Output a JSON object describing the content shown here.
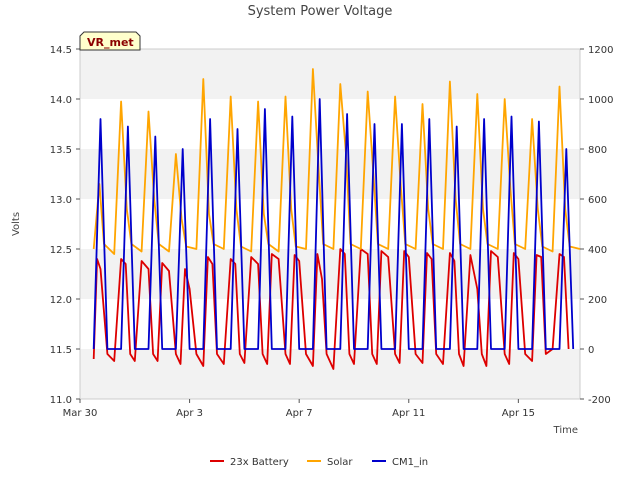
{
  "chart_data": {
    "type": "line",
    "title": "System Power Voltage",
    "xlabel": "Time",
    "ylabel": "Volts",
    "badge": "VR_met",
    "x_range": [
      "2024-03-30",
      "2024-04-17T06:00"
    ],
    "x_ticks": [
      "Mar 30",
      "Apr 3",
      "Apr 7",
      "Apr 11",
      "Apr 15"
    ],
    "x_tick_dates": [
      "2024-03-30",
      "2024-04-03",
      "2024-04-07",
      "2024-04-11",
      "2024-04-15"
    ],
    "ylim_left": [
      11.0,
      14.5
    ],
    "y_ticks_left": [
      "11.0",
      "11.5",
      "12.0",
      "12.5",
      "13.0",
      "13.5",
      "14.0",
      "14.5"
    ],
    "ylim_right": [
      -200,
      1200
    ],
    "y_ticks_right": [
      "-200",
      "0",
      "200",
      "400",
      "600",
      "800",
      "1000",
      "1200"
    ],
    "grid": "horizontal bands",
    "legend_position": "bottom-center",
    "series": [
      {
        "name": "23x Battery",
        "axis": "left",
        "color": "#dd0000",
        "x": [
          "2024-03-30T12:00",
          "2024-03-30T15:00",
          "2024-03-30T18:00",
          "2024-03-31T00:00",
          "2024-03-31T06:00",
          "2024-03-31T12:00",
          "2024-03-31T16:00",
          "2024-03-31T20:00",
          "2024-04-01T00:00",
          "2024-04-01T06:00",
          "2024-04-01T12:00",
          "2024-04-01T16:00",
          "2024-04-01T20:00",
          "2024-04-02T00:00",
          "2024-04-02T06:00",
          "2024-04-02T12:00",
          "2024-04-02T16:00",
          "2024-04-02T20:00",
          "2024-04-03T00:00",
          "2024-04-03T06:00",
          "2024-04-03T12:00",
          "2024-04-03T16:00",
          "2024-04-03T20:00",
          "2024-04-04T00:00",
          "2024-04-04T06:00",
          "2024-04-04T12:00",
          "2024-04-04T16:00",
          "2024-04-04T20:00",
          "2024-04-05T00:00",
          "2024-04-05T06:00",
          "2024-04-05T12:00",
          "2024-04-05T16:00",
          "2024-04-05T20:00",
          "2024-04-06T00:00",
          "2024-04-06T06:00",
          "2024-04-06T12:00",
          "2024-04-06T16:00",
          "2024-04-06T20:00",
          "2024-04-07T00:00",
          "2024-04-07T06:00",
          "2024-04-07T12:00",
          "2024-04-07T16:00",
          "2024-04-07T20:00",
          "2024-04-08T00:00",
          "2024-04-08T06:00",
          "2024-04-08T12:00",
          "2024-04-08T16:00",
          "2024-04-08T20:00",
          "2024-04-09T00:00",
          "2024-04-09T06:00",
          "2024-04-09T12:00",
          "2024-04-09T16:00",
          "2024-04-09T20:00",
          "2024-04-10T00:00",
          "2024-04-10T06:00",
          "2024-04-10T12:00",
          "2024-04-10T16:00",
          "2024-04-10T20:00",
          "2024-04-11T00:00",
          "2024-04-11T06:00",
          "2024-04-11T12:00",
          "2024-04-11T16:00",
          "2024-04-11T20:00",
          "2024-04-12T00:00",
          "2024-04-12T06:00",
          "2024-04-12T12:00",
          "2024-04-12T16:00",
          "2024-04-12T20:00",
          "2024-04-13T00:00",
          "2024-04-13T06:00",
          "2024-04-13T12:00",
          "2024-04-13T16:00",
          "2024-04-13T20:00",
          "2024-04-14T00:00",
          "2024-04-14T06:00",
          "2024-04-14T12:00",
          "2024-04-14T16:00",
          "2024-04-14T20:00",
          "2024-04-15T00:00",
          "2024-04-15T06:00",
          "2024-04-15T12:00",
          "2024-04-15T16:00",
          "2024-04-15T20:00",
          "2024-04-16T00:00",
          "2024-04-16T06:00",
          "2024-04-16T12:00",
          "2024-04-16T16:00",
          "2024-04-16T20:00"
        ],
        "y": [
          11.4,
          12.4,
          12.3,
          11.45,
          11.38,
          12.4,
          12.35,
          11.45,
          11.38,
          12.38,
          12.3,
          11.45,
          11.38,
          12.36,
          12.28,
          11.45,
          11.35,
          12.3,
          12.1,
          11.45,
          11.33,
          12.42,
          12.35,
          11.45,
          11.35,
          12.4,
          12.35,
          11.45,
          11.36,
          12.42,
          12.35,
          11.45,
          11.35,
          12.45,
          12.4,
          11.45,
          11.35,
          12.44,
          12.38,
          11.45,
          11.33,
          12.45,
          12.2,
          11.45,
          11.3,
          12.5,
          12.45,
          11.45,
          11.35,
          12.5,
          12.45,
          11.45,
          11.35,
          12.48,
          12.42,
          11.45,
          11.36,
          12.48,
          12.42,
          11.45,
          11.36,
          12.46,
          12.4,
          11.45,
          11.35,
          12.46,
          12.38,
          11.45,
          11.33,
          12.44,
          12.1,
          11.45,
          11.33,
          12.48,
          12.42,
          11.45,
          11.35,
          12.46,
          12.4,
          11.45,
          11.38,
          12.44,
          12.42,
          11.45,
          11.5,
          12.45,
          12.42,
          11.5
        ]
      },
      {
        "name": "Solar",
        "axis": "right",
        "color": "#ffa500",
        "x": [
          "2024-03-30T12:00",
          "2024-03-30T17:00",
          "2024-03-30T21:00",
          "2024-03-31T06:00",
          "2024-03-31T12:00",
          "2024-03-31T17:00",
          "2024-03-31T21:00",
          "2024-04-01T06:00",
          "2024-04-01T12:00",
          "2024-04-01T17:00",
          "2024-04-01T21:00",
          "2024-04-02T06:00",
          "2024-04-02T12:00",
          "2024-04-02T17:00",
          "2024-04-02T21:00",
          "2024-04-03T06:00",
          "2024-04-03T12:00",
          "2024-04-03T17:00",
          "2024-04-03T21:00",
          "2024-04-04T06:00",
          "2024-04-04T12:00",
          "2024-04-04T17:00",
          "2024-04-04T21:00",
          "2024-04-05T06:00",
          "2024-04-05T12:00",
          "2024-04-05T17:00",
          "2024-04-05T21:00",
          "2024-04-06T06:00",
          "2024-04-06T12:00",
          "2024-04-06T17:00",
          "2024-04-06T21:00",
          "2024-04-07T06:00",
          "2024-04-07T12:00",
          "2024-04-07T17:00",
          "2024-04-07T21:00",
          "2024-04-08T06:00",
          "2024-04-08T12:00",
          "2024-04-08T17:00",
          "2024-04-08T21:00",
          "2024-04-09T06:00",
          "2024-04-09T12:00",
          "2024-04-09T17:00",
          "2024-04-09T21:00",
          "2024-04-10T06:00",
          "2024-04-10T12:00",
          "2024-04-10T17:00",
          "2024-04-10T21:00",
          "2024-04-11T06:00",
          "2024-04-11T12:00",
          "2024-04-11T17:00",
          "2024-04-11T21:00",
          "2024-04-12T06:00",
          "2024-04-12T12:00",
          "2024-04-12T17:00",
          "2024-04-12T21:00",
          "2024-04-13T06:00",
          "2024-04-13T12:00",
          "2024-04-13T17:00",
          "2024-04-13T21:00",
          "2024-04-14T06:00",
          "2024-04-14T12:00",
          "2024-04-14T17:00",
          "2024-04-14T21:00",
          "2024-04-15T06:00",
          "2024-04-15T12:00",
          "2024-04-15T17:00",
          "2024-04-15T21:00",
          "2024-04-16T06:00",
          "2024-04-16T12:00",
          "2024-04-16T17:00",
          "2024-04-16T21:00",
          "2024-04-17T06:00"
        ],
        "y": [
          400,
          660,
          420,
          380,
          990,
          560,
          420,
          390,
          950,
          600,
          420,
          390,
          780,
          520,
          410,
          400,
          1080,
          540,
          420,
          400,
          1010,
          560,
          410,
          390,
          990,
          540,
          420,
          390,
          1010,
          560,
          410,
          400,
          1120,
          720,
          420,
          400,
          1060,
          780,
          420,
          400,
          1030,
          700,
          420,
          400,
          1010,
          650,
          420,
          400,
          980,
          560,
          420,
          400,
          1070,
          600,
          420,
          400,
          1020,
          560,
          420,
          400,
          1000,
          640,
          420,
          400,
          920,
          560,
          410,
          390,
          1050,
          560,
          410,
          400
        ]
      },
      {
        "name": "CM1_in",
        "axis": "right",
        "color": "#0000cc",
        "x": [
          "2024-03-30T12:00",
          "2024-03-30T18:00",
          "2024-03-31T00:00",
          "2024-03-31T12:00",
          "2024-03-31T18:00",
          "2024-04-01T00:00",
          "2024-04-01T12:00",
          "2024-04-01T18:00",
          "2024-04-02T00:00",
          "2024-04-02T12:00",
          "2024-04-02T18:00",
          "2024-04-03T00:00",
          "2024-04-03T12:00",
          "2024-04-03T18:00",
          "2024-04-04T00:00",
          "2024-04-04T12:00",
          "2024-04-04T18:00",
          "2024-04-05T00:00",
          "2024-04-05T12:00",
          "2024-04-05T18:00",
          "2024-04-06T00:00",
          "2024-04-06T12:00",
          "2024-04-06T18:00",
          "2024-04-07T00:00",
          "2024-04-07T12:00",
          "2024-04-07T18:00",
          "2024-04-08T00:00",
          "2024-04-08T12:00",
          "2024-04-08T18:00",
          "2024-04-09T00:00",
          "2024-04-09T12:00",
          "2024-04-09T18:00",
          "2024-04-10T00:00",
          "2024-04-10T12:00",
          "2024-04-10T18:00",
          "2024-04-11T00:00",
          "2024-04-11T12:00",
          "2024-04-11T18:00",
          "2024-04-12T00:00",
          "2024-04-12T12:00",
          "2024-04-12T18:00",
          "2024-04-13T00:00",
          "2024-04-13T12:00",
          "2024-04-13T18:00",
          "2024-04-14T00:00",
          "2024-04-14T12:00",
          "2024-04-14T18:00",
          "2024-04-15T00:00",
          "2024-04-15T12:00",
          "2024-04-15T18:00",
          "2024-04-16T00:00",
          "2024-04-16T12:00",
          "2024-04-16T18:00",
          "2024-04-17T00:00"
        ],
        "y": [
          0,
          920,
          0,
          0,
          890,
          0,
          0,
          850,
          0,
          0,
          800,
          0,
          0,
          920,
          0,
          0,
          880,
          0,
          0,
          960,
          0,
          0,
          930,
          0,
          0,
          1000,
          0,
          0,
          940,
          0,
          0,
          900,
          0,
          0,
          900,
          0,
          0,
          920,
          0,
          0,
          890,
          0,
          0,
          920,
          0,
          0,
          930,
          0,
          0,
          910,
          0,
          0,
          800,
          0
        ]
      }
    ]
  }
}
